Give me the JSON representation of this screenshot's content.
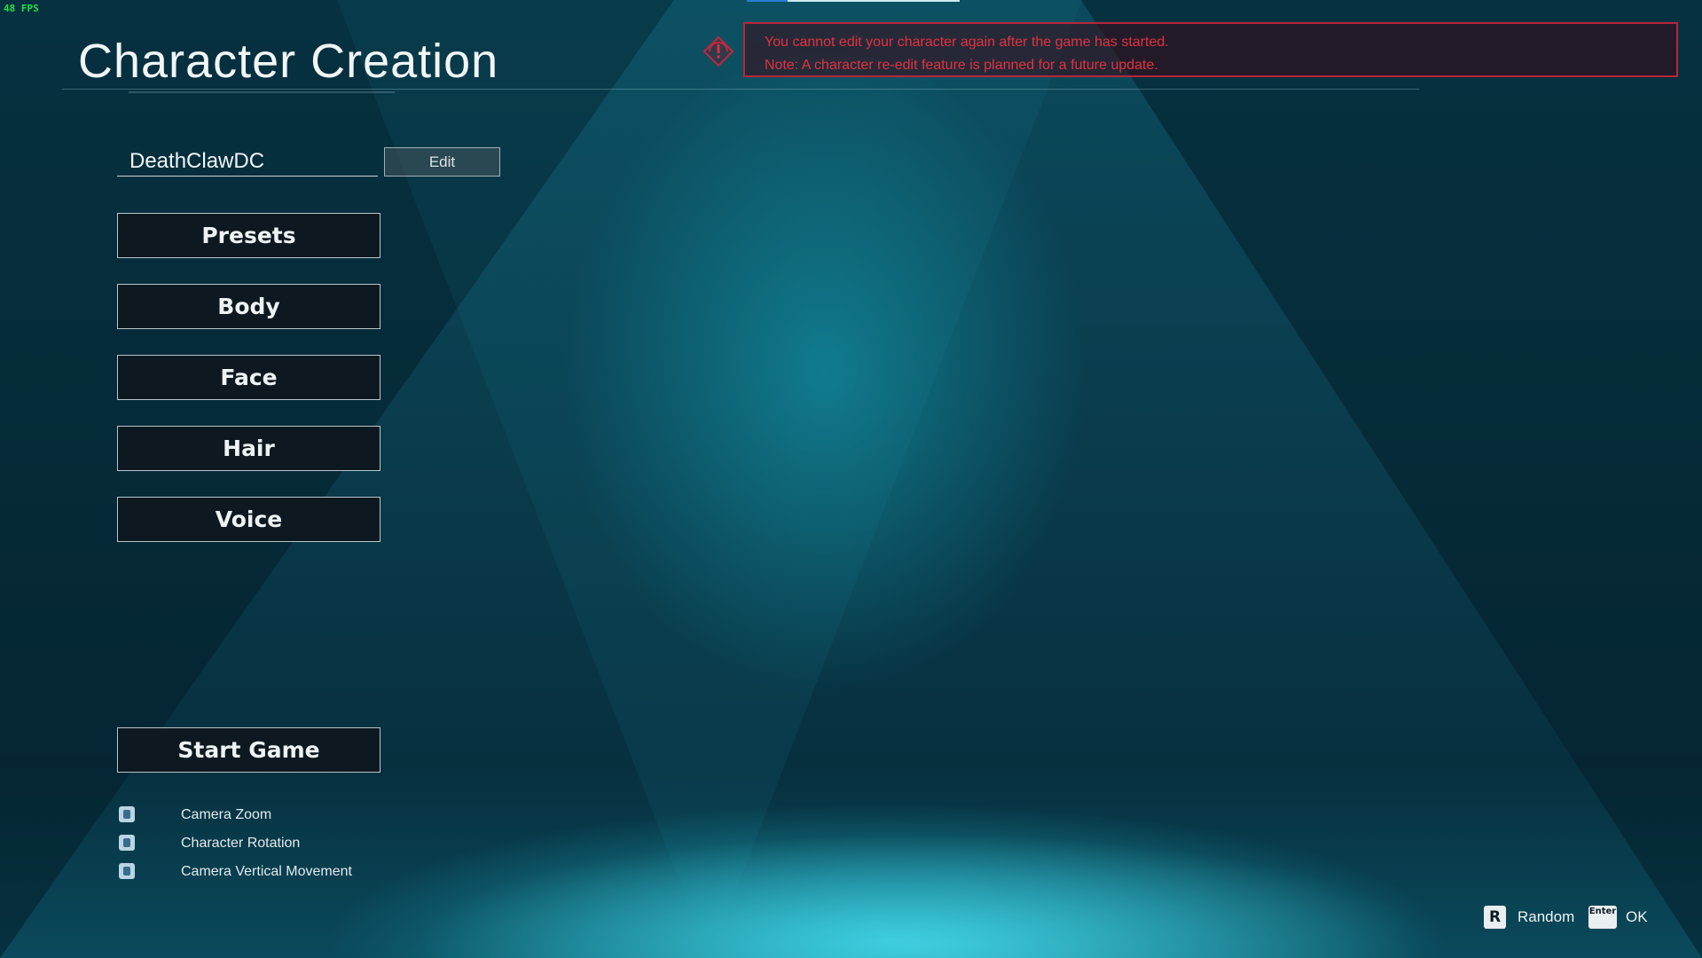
{
  "overlay": {
    "fps": "48 FPS"
  },
  "page": {
    "title": "Character Creation"
  },
  "warning": {
    "color": "#e2323f",
    "lines": [
      "You cannot edit your character again after the game has started.",
      "Note: A character re-edit feature is planned for a future update."
    ]
  },
  "name_field": {
    "value": "DeathClawDC",
    "edit_label": "Edit"
  },
  "menu": {
    "items": [
      {
        "label": "Presets"
      },
      {
        "label": "Body"
      },
      {
        "label": "Face"
      },
      {
        "label": "Hair"
      },
      {
        "label": "Voice"
      }
    ],
    "start_label": "Start Game"
  },
  "controls": [
    {
      "icon": "mouse-wheel-icon",
      "label": "Camera Zoom"
    },
    {
      "icon": "mouse-drag-icon",
      "label": "Character Rotation"
    },
    {
      "icon": "mouse-vertical-icon",
      "label": "Camera Vertical Movement"
    }
  ],
  "hints": [
    {
      "key": "R",
      "label": "Random"
    },
    {
      "key": "Enter",
      "label": "OK"
    }
  ]
}
